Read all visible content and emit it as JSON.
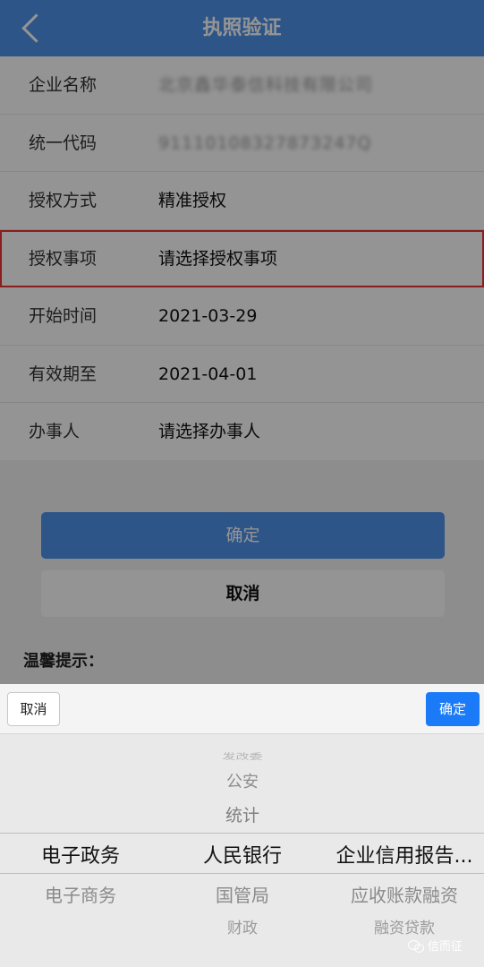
{
  "header": {
    "title": "执照验证"
  },
  "form": {
    "rows": [
      {
        "label": "企业名称",
        "value": "北京鑫华泰信科技有限公司"
      },
      {
        "label": "统一代码",
        "value": "91110108327873247Q"
      },
      {
        "label": "授权方式",
        "value": "精准授权"
      },
      {
        "label": "授权事项",
        "value": "请选择授权事项"
      },
      {
        "label": "开始时间",
        "value": "2021-03-29"
      },
      {
        "label": "有效期至",
        "value": "2021-04-01"
      },
      {
        "label": "办事人",
        "value": "请选择办事人"
      }
    ]
  },
  "actions": {
    "confirm": "确定",
    "cancel": "取消"
  },
  "tips": {
    "label": "温馨提示："
  },
  "picker": {
    "cancel": "取消",
    "confirm": "确定",
    "columns": [
      {
        "items": [
          "电子政务",
          "电子商务"
        ]
      },
      {
        "items": [
          "发改委",
          "公安",
          "统计",
          "人民银行",
          "国管局",
          "财政"
        ]
      },
      {
        "items": [
          "企业信用报告...",
          "应收账款融资",
          "融资贷款"
        ]
      }
    ]
  },
  "watermark": {
    "text": "信而征"
  },
  "colors": {
    "primary": "#4f93ea",
    "picker_confirm": "#1a7af8",
    "highlight_border": "#e33333"
  }
}
